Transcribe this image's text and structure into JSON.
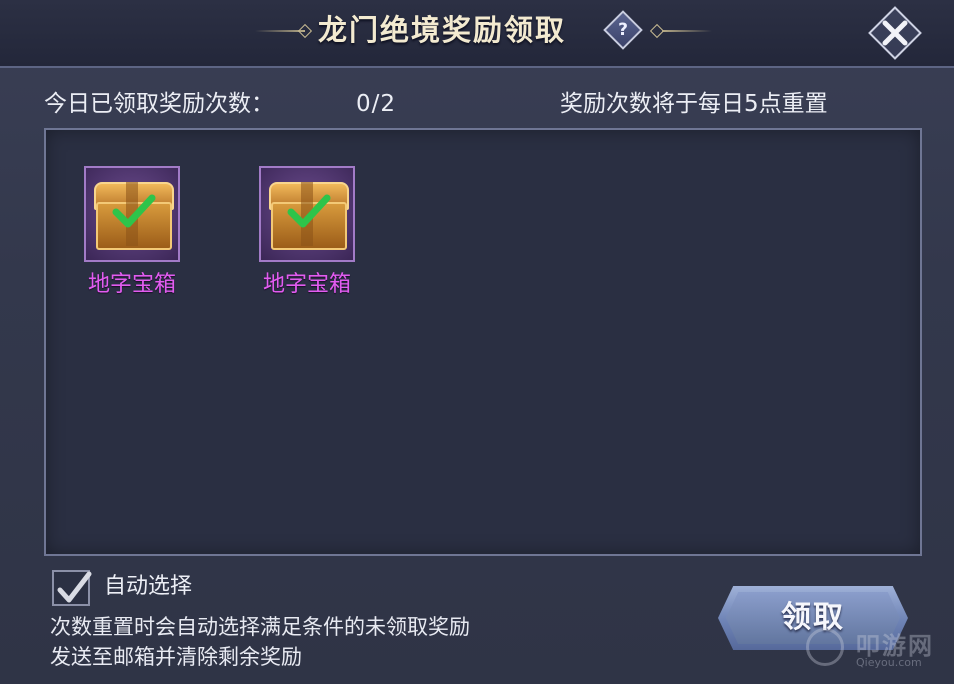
{
  "dialog": {
    "title": "龙门绝境奖励领取",
    "help_icon": "question-mark-icon",
    "help_label": "?",
    "close_icon": "close-x-icon"
  },
  "info": {
    "claimed_label": "今日已领取奖励次数：",
    "claimed_count": "0/2",
    "reset_note": "奖励次数将于每日5点重置"
  },
  "rewards": [
    {
      "name": "地字宝箱",
      "icon": "treasure-chest-icon",
      "checked": true
    },
    {
      "name": "地字宝箱",
      "icon": "treasure-chest-icon",
      "checked": true
    }
  ],
  "auto_select": {
    "label": "自动选择",
    "checked": true,
    "description_line1": "次数重置时会自动选择满足条件的未领取奖励",
    "description_line2": "发送至邮箱并清除剩余奖励"
  },
  "actions": {
    "claim_label": "领取"
  },
  "watermark": {
    "main": "叩游网",
    "sub": "Qieyou.com"
  },
  "colors": {
    "reward_name": "#e25cf0",
    "check": "#2ec44a",
    "rarity_frame": "#a27bc7"
  }
}
